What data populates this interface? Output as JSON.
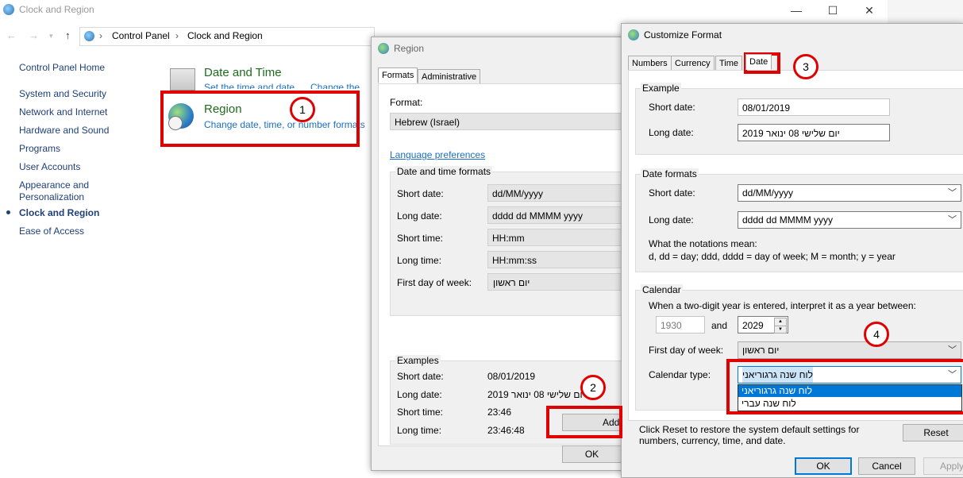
{
  "control_panel": {
    "title": "Clock and Region",
    "breadcrumb": [
      "Control Panel",
      "Clock and Region"
    ],
    "sidebar": [
      "Control Panel Home",
      "System and Security",
      "Network and Internet",
      "Hardware and Sound",
      "Programs",
      "User Accounts",
      "Appearance and",
      "Personalization",
      "Clock and Region",
      "Ease of Access"
    ],
    "date_time": {
      "title": "Date and Time",
      "sub1": "Set the time and date",
      "sub2": "Change the tim"
    },
    "region": {
      "title": "Region",
      "sub": "Change date, time, or number formats"
    }
  },
  "region_dialog": {
    "title": "Region",
    "tabs": [
      "Formats",
      "Administrative"
    ],
    "format_label": "Format:",
    "format_value": "Hebrew (Israel)",
    "lang_pref": "Language preferences",
    "dt_group": "Date and time formats",
    "rows": [
      {
        "label": "Short date:",
        "value": "dd/MM/yyyy"
      },
      {
        "label": "Long date:",
        "value": "dddd dd MMMM yyyy"
      },
      {
        "label": "Short time:",
        "value": "HH:mm"
      },
      {
        "label": "Long time:",
        "value": "HH:mm:ss"
      },
      {
        "label": "First day of week:",
        "value": "יום ראשון"
      }
    ],
    "examples_group": "Examples",
    "examples": [
      {
        "label": "Short date:",
        "value": "08/01/2019"
      },
      {
        "label": "Long date:",
        "value": "יום שלישי 08 ינואר 2019"
      },
      {
        "label": "Short time:",
        "value": "23:46"
      },
      {
        "label": "Long time:",
        "value": "23:46:48"
      }
    ],
    "additional_btn": "Addi",
    "ok_btn": "OK"
  },
  "customize_dialog": {
    "title": "Customize Format",
    "tabs": [
      "Numbers",
      "Currency",
      "Time",
      "Date"
    ],
    "example_group": "Example",
    "ex_short_label": "Short date:",
    "ex_short_value": "08/01/2019",
    "ex_long_label": "Long date:",
    "ex_long_value": "יום שלישי 08 ינואר 2019",
    "formats_group": "Date formats",
    "fmt_short_label": "Short date:",
    "fmt_short_value": "dd/MM/yyyy",
    "fmt_long_label": "Long date:",
    "fmt_long_value": "dddd dd MMMM yyyy",
    "notation_title": "What the notations mean:",
    "notation_text": "d, dd = day;  ddd, dddd = day of week;  M = month;  y = year",
    "calendar_group": "Calendar",
    "two_digit_text": "When a two-digit year is entered, interpret it as a year between:",
    "year_from": "1930",
    "and_label": "and",
    "year_to": "2029",
    "first_day_label": "First day of week:",
    "first_day_value": "יום ראשון",
    "cal_type_label": "Calendar type:",
    "cal_type_value": "לוח שנה גרגוריאני",
    "cal_options": [
      "לוח שנה גרגוריאני",
      "לוח שנה עברי"
    ],
    "reset_text": "Click Reset to restore the system default settings for numbers, currency, time, and date.",
    "reset_btn": "Reset",
    "ok_btn": "OK",
    "cancel_btn": "Cancel",
    "apply_btn": "Apply"
  },
  "annotations": [
    "1",
    "2",
    "3",
    "4"
  ]
}
